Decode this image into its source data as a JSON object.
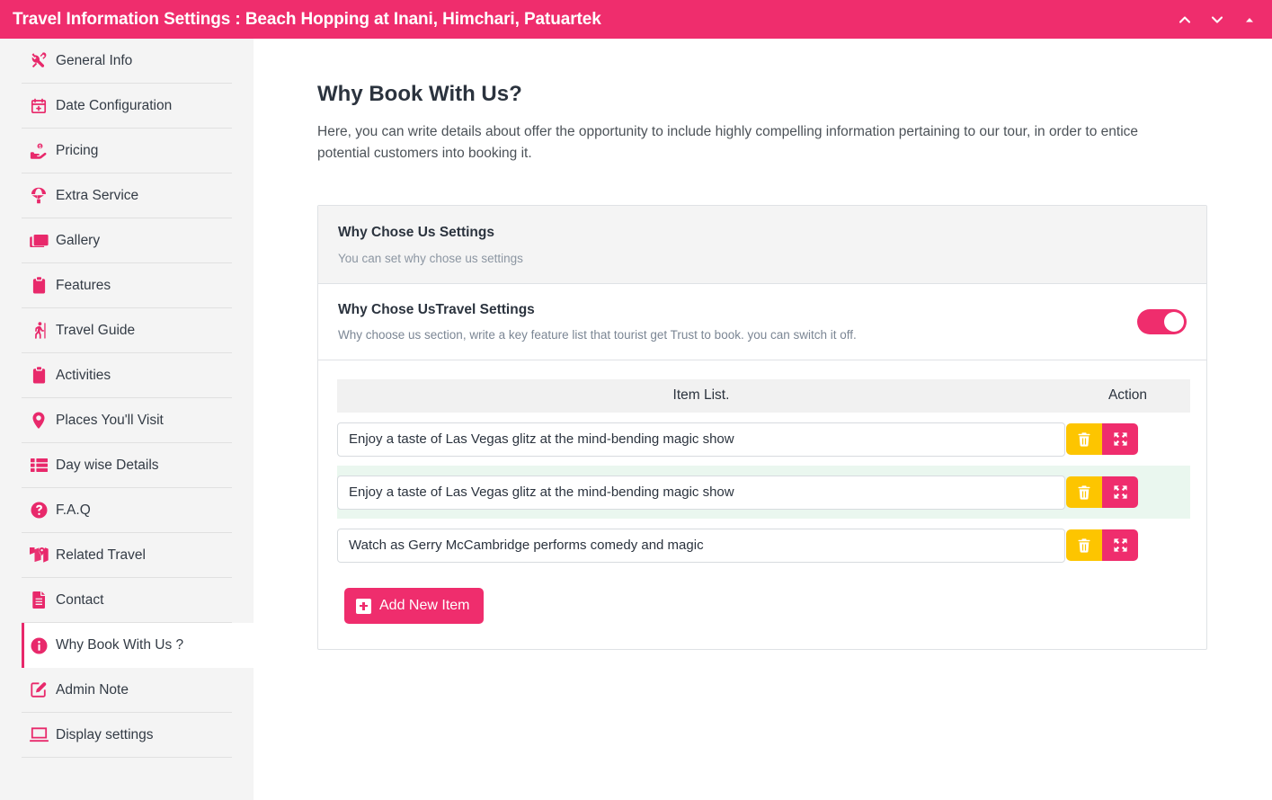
{
  "titlebar": {
    "title": "Travel Information Settings : Beach Hopping at Inani, Himchari, Patuartek",
    "controls": [
      {
        "name": "chevron-up-icon"
      },
      {
        "name": "chevron-down-icon"
      },
      {
        "name": "caret-up-icon"
      }
    ],
    "bg_color": "#ef2d6d"
  },
  "sidebar": {
    "items": [
      {
        "label": "General Info",
        "icon": "tools-icon",
        "active": false
      },
      {
        "label": "Date Configuration",
        "icon": "calendar-plus-icon",
        "active": false
      },
      {
        "label": "Pricing",
        "icon": "hand-money-icon",
        "active": false
      },
      {
        "label": "Extra Service",
        "icon": "parachute-icon",
        "active": false
      },
      {
        "label": "Gallery",
        "icon": "images-icon",
        "active": false
      },
      {
        "label": "Features",
        "icon": "clipboard-list-icon",
        "active": false
      },
      {
        "label": "Travel Guide",
        "icon": "hiking-icon",
        "active": false
      },
      {
        "label": "Activities",
        "icon": "clipboard-list-icon",
        "active": false
      },
      {
        "label": "Places You'll Visit",
        "icon": "map-marker-icon",
        "active": false
      },
      {
        "label": "Day wise Details",
        "icon": "list-icon",
        "active": false
      },
      {
        "label": "F.A.Q",
        "icon": "question-circle-icon",
        "active": false
      },
      {
        "label": "Related Travel",
        "icon": "map-marked-icon",
        "active": false
      },
      {
        "label": "Contact",
        "icon": "file-alt-icon",
        "active": false
      },
      {
        "label": "Why Book With Us ?",
        "icon": "info-circle-icon",
        "active": true
      },
      {
        "label": "Admin Note",
        "icon": "edit-icon",
        "active": false
      },
      {
        "label": "Display settings",
        "icon": "display-icon",
        "active": false
      }
    ],
    "accent_color": "#e8296b"
  },
  "main": {
    "page_title": "Why Book With Us?",
    "page_desc": "Here, you can write details about offer the opportunity to include highly compelling information pertaining to our tour, in order to entice potential customers into booking it.",
    "card": {
      "header_title": "Why Chose Us Settings",
      "header_sub": "You can set why chose us settings",
      "toggle_title": "Why Chose UsTravel Settings",
      "toggle_sub": "Why choose us section, write a key feature list that tourist get Trust to book. you can switch it off.",
      "toggle_on": true,
      "table": {
        "headers": [
          "Item List.",
          "Action"
        ],
        "rows": [
          {
            "value": "Enjoy a taste of Las Vegas glitz at the mind-bending magic show",
            "highlighted": false
          },
          {
            "value": "Enjoy a taste of Las Vegas glitz at the mind-bending magic show",
            "highlighted": true
          },
          {
            "value": "Watch as Gerry McCambridge performs comedy and magic",
            "highlighted": false
          }
        ],
        "delete_color": "#fdc500",
        "move_color": "#ef2d6d"
      },
      "add_button_label": "Add New Item"
    }
  }
}
